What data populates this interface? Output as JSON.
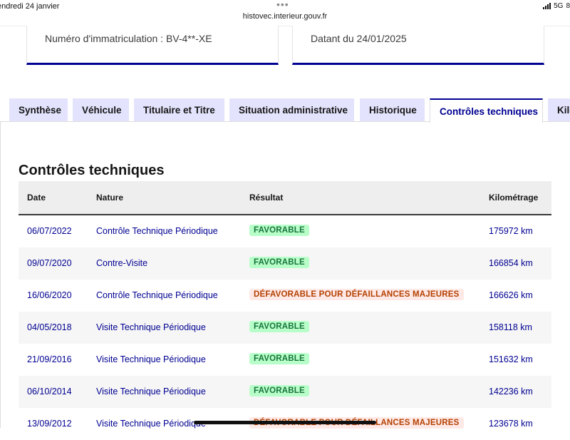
{
  "status_bar": {
    "date": "endredi 24 janvier",
    "url": "histovec.interieur.gouv.fr",
    "network": "5G",
    "battery": "8"
  },
  "cards": {
    "immatriculation": "Numéro d'immatriculation : BV-4**-XE",
    "datant": "Datant du 24/01/2025"
  },
  "tabs": [
    {
      "label": "Synthèse"
    },
    {
      "label": "Véhicule"
    },
    {
      "label": "Titulaire et Titre"
    },
    {
      "label": "Situation administrative"
    },
    {
      "label": "Historique"
    },
    {
      "label": "Contrôles techniques"
    },
    {
      "label": "Kilo"
    }
  ],
  "active_tab": "Contrôles techniques",
  "section_title": "Contrôles techniques",
  "table": {
    "headers": {
      "date": "Date",
      "nature": "Nature",
      "resultat": "Résultat",
      "km": "Kilométrage"
    },
    "rows": [
      {
        "date": "06/07/2022",
        "nature": "Contrôle Technique Périodique",
        "resultat": "FAVORABLE",
        "status": "ok",
        "km": "175972 km"
      },
      {
        "date": "09/07/2020",
        "nature": "Contre-Visite",
        "resultat": "FAVORABLE",
        "status": "ok",
        "km": "166854 km"
      },
      {
        "date": "16/06/2020",
        "nature": "Contrôle Technique Périodique",
        "resultat": "DÉFAVORABLE POUR DÉFAILLANCES MAJEURES",
        "status": "ko",
        "km": "166626 km"
      },
      {
        "date": "04/05/2018",
        "nature": "Visite Technique Périodique",
        "resultat": "FAVORABLE",
        "status": "ok",
        "km": "158118 km"
      },
      {
        "date": "21/09/2016",
        "nature": "Visite Technique Périodique",
        "resultat": "FAVORABLE",
        "status": "ok",
        "km": "151632 km"
      },
      {
        "date": "06/10/2014",
        "nature": "Visite Technique Périodique",
        "resultat": "FAVORABLE",
        "status": "ok",
        "km": "142236 km"
      },
      {
        "date": "13/09/2012",
        "nature": "Visite Technique Périodique",
        "resultat": "DÉFAVORABLE POUR DÉFAILLANCES MAJEURES",
        "status": "ko",
        "km": "123678 km"
      }
    ]
  },
  "colors": {
    "accent": "#000091",
    "favorable": "#18753c",
    "defavorable": "#b34000"
  }
}
